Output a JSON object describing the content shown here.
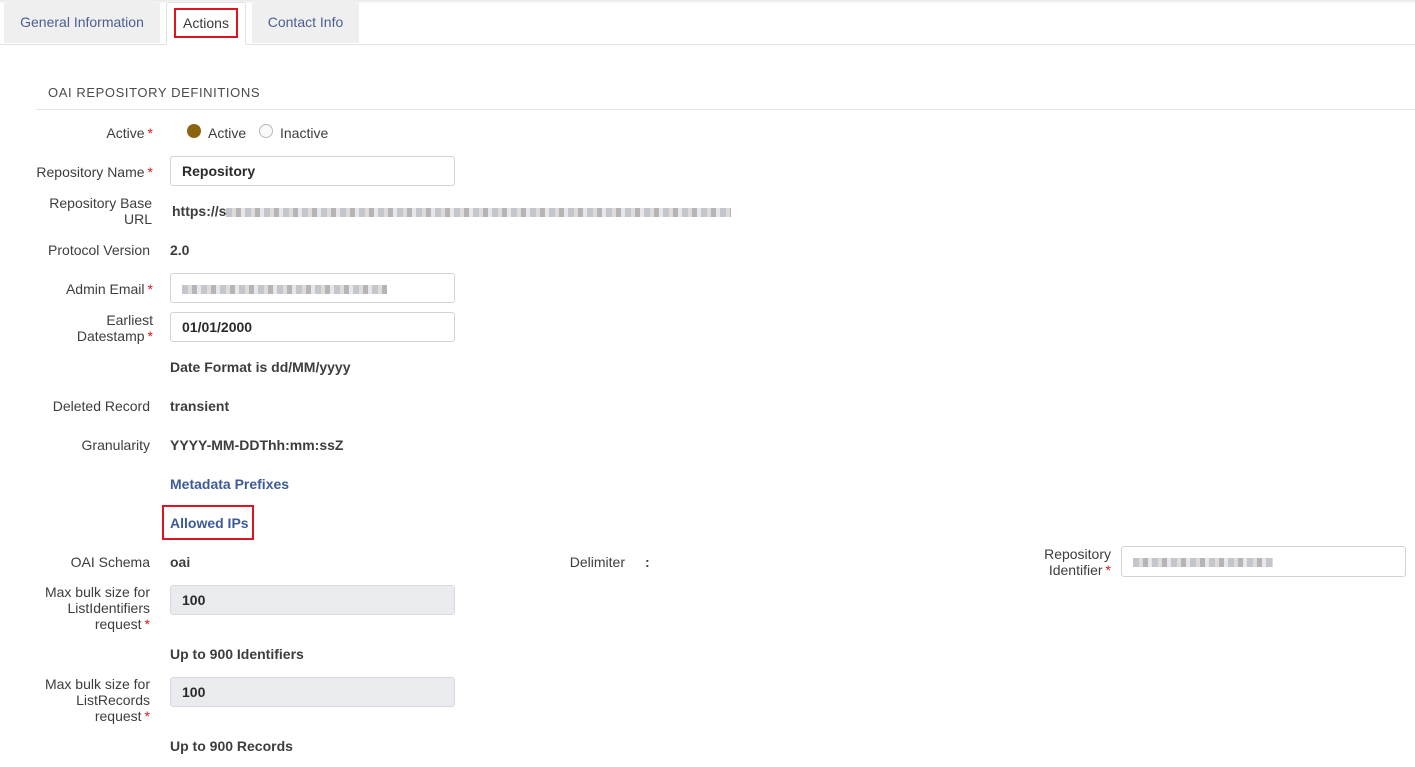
{
  "tabs": [
    {
      "label": "General Information",
      "active": false
    },
    {
      "label": "Actions",
      "active": true
    },
    {
      "label": "Contact Info",
      "active": false
    }
  ],
  "section": {
    "title": "OAI REPOSITORY DEFINITIONS"
  },
  "fields": {
    "active": {
      "label": "Active",
      "required": "*",
      "options": [
        {
          "label": "Active",
          "selected": true
        },
        {
          "label": "Inactive",
          "selected": false
        }
      ]
    },
    "repository_name": {
      "label": "Repository Name",
      "required": "*",
      "value": "Repository"
    },
    "repository_base_url": {
      "label_line1": "Repository Base",
      "label_line2": "URL",
      "value_prefix": "https://s",
      "value_blurred": true
    },
    "protocol_version": {
      "label": "Protocol Version",
      "value": "2.0"
    },
    "admin_email": {
      "label": "Admin Email",
      "required": "*",
      "value_blurred": true
    },
    "earliest_datestamp": {
      "label_line1": "Earliest",
      "label_line2": "Datestamp",
      "required": "*",
      "value": "01/01/2000",
      "hint": "Date Format is dd/MM/yyyy"
    },
    "deleted_record": {
      "label": "Deleted Record",
      "value": "transient"
    },
    "granularity": {
      "label": "Granularity",
      "value": "YYYY-MM-DDThh:mm:ssZ"
    },
    "links": {
      "metadata_prefixes": "Metadata Prefixes",
      "allowed_ips": "Allowed IPs"
    },
    "oai_schema": {
      "label": "OAI Schema",
      "value": "oai"
    },
    "delimiter": {
      "label": "Delimiter",
      "value": ":"
    },
    "repository_identifier": {
      "label_line1": "Repository",
      "label_line2": "Identifier",
      "required": "*",
      "value_blurred": true
    },
    "max_list_identifiers": {
      "label_line1": "Max bulk size for",
      "label_line2": "ListIdentifiers",
      "label_line3": "request",
      "required": "*",
      "value": "100",
      "hint": "Up to 900 Identifiers"
    },
    "max_list_records": {
      "label_line1": "Max bulk size for",
      "label_line2": "ListRecords",
      "label_line3": "request",
      "required": "*",
      "value": "100",
      "hint": "Up to 900 Records"
    }
  },
  "colors": {
    "accent_radio": "#8b6412",
    "link": "#3d5a99",
    "required": "#e0141e",
    "highlight_box": "#e0141e"
  }
}
